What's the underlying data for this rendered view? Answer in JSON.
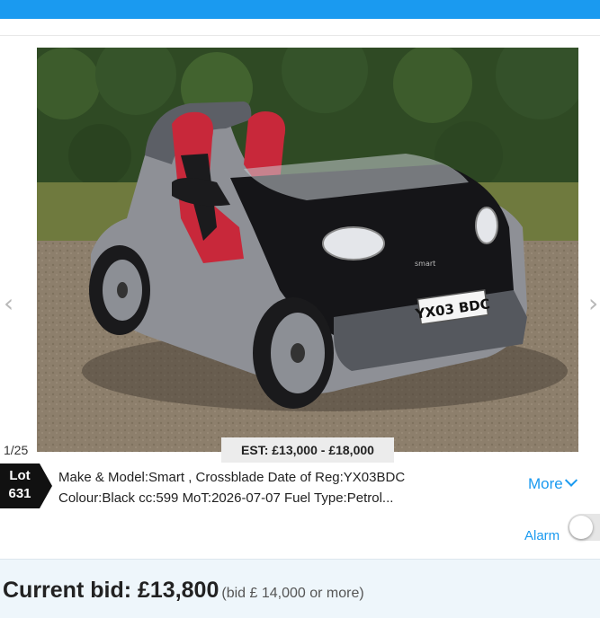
{
  "gallery": {
    "counter": "1/25",
    "estimate": "EST: £13,000 - £18,000",
    "plate": "YX03 BDC",
    "badge": "smart",
    "prev_arrow": "‹",
    "next_arrow": "›"
  },
  "lot": {
    "label": "Lot",
    "number": "631"
  },
  "description": {
    "line1": "Make & Model:Smart , Crossblade Date of Reg:YX03BDC",
    "line2": "Colour:Black cc:599 MoT:2026-07-07 Fuel Type:Petrol..."
  },
  "actions": {
    "more_label": "More",
    "alarm_label": "Alarm",
    "alarm_on": false
  },
  "bid": {
    "current": "Current bid: £13,800",
    "next": "(bid £ 14,000 or more)"
  },
  "colors": {
    "accent": "#1a9af0",
    "lot_badge": "#111111",
    "bid_bar": "#eef6fb"
  }
}
